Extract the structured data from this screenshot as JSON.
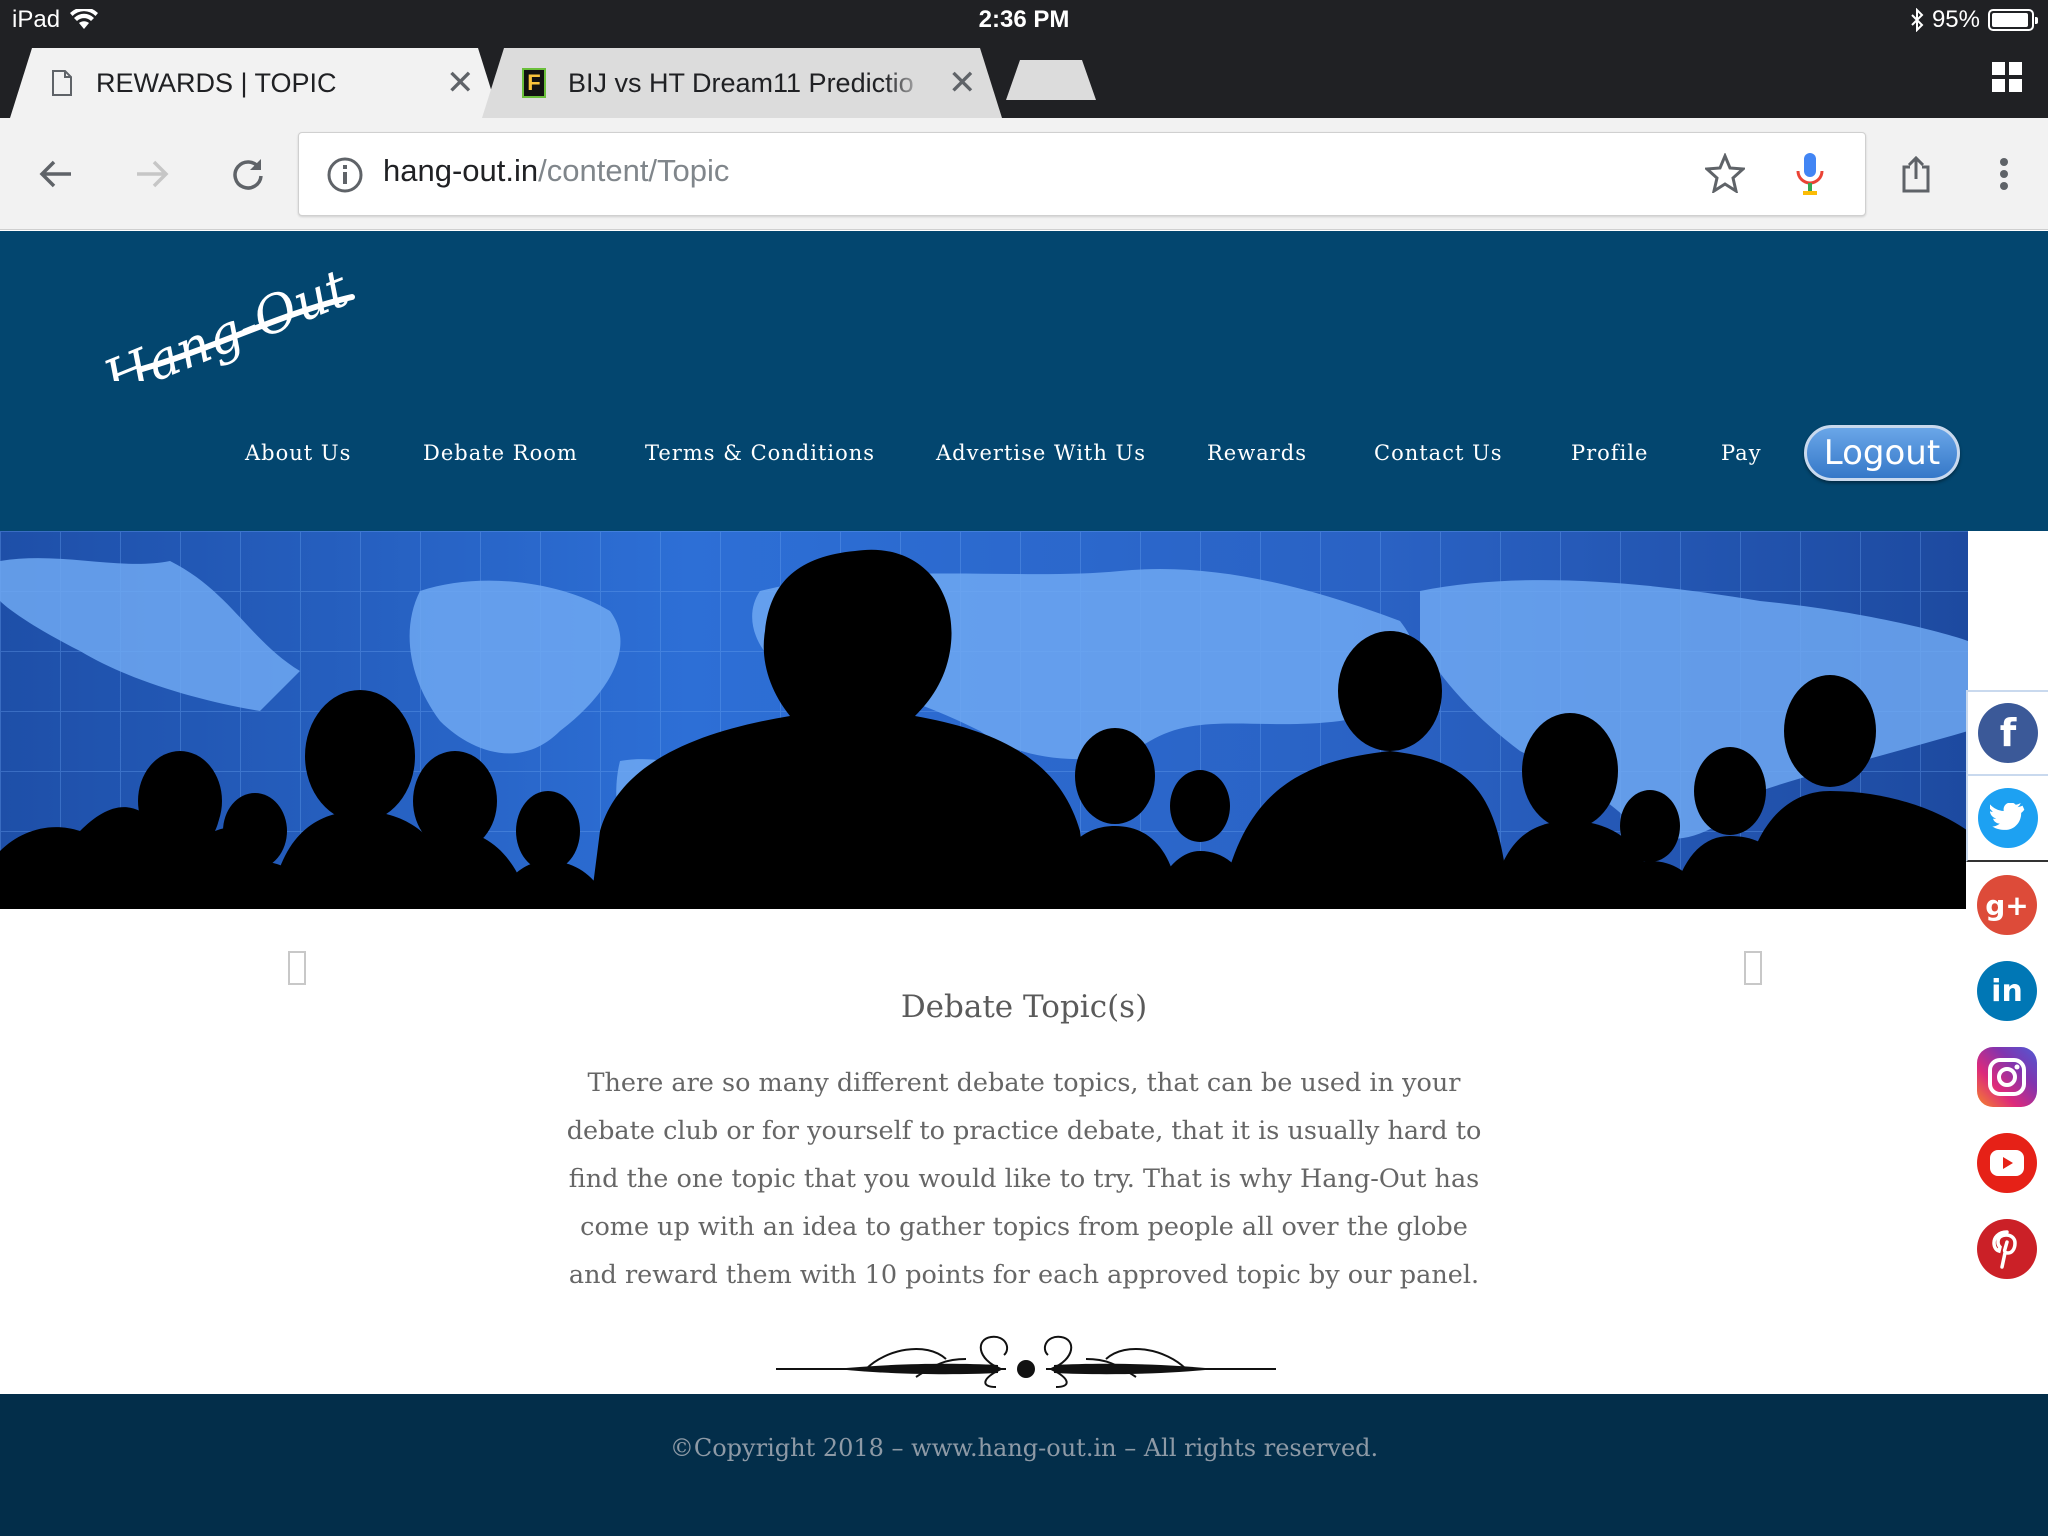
{
  "status_bar": {
    "device": "iPad",
    "time": "2:36 PM",
    "battery": "95%",
    "battery_level": 0.95
  },
  "tabs": [
    {
      "title": "REWARDS | TOPIC",
      "active": true
    },
    {
      "title": "BIJ vs HT Dream11 Predictio",
      "active": false,
      "favicon": "F"
    }
  ],
  "toolbar": {
    "url_host": "hang-out.in",
    "url_path": "/content/Topic"
  },
  "site": {
    "logo_text": "Hang-Out",
    "nav": [
      "About Us",
      "Debate Room",
      "Terms & Conditions",
      "Advertise With Us",
      "Rewards",
      "Contact Us",
      "Profile",
      "Pay"
    ],
    "logout_label": "Logout",
    "header_color": "#03466f",
    "footer_color": "#032e4a"
  },
  "social": [
    "facebook-icon",
    "twitter-icon",
    "google-plus-icon",
    "linkedin-icon",
    "instagram-icon",
    "youtube-icon",
    "pinterest-icon"
  ],
  "social_glyphs": {
    "facebook": "f",
    "google_plus": "g+",
    "linkedin": "in"
  },
  "content": {
    "title": "Debate Topic(s)",
    "body": "There are so many different debate topics, that can be used in your debate club or for yourself to practice debate, that it is usually hard to find the one topic that you would like to try. That is why Hang-Out has come up with an idea to gather topics from people all over the globe and reward them with 10 points for each approved topic by our panel."
  },
  "footer": {
    "copyright": "©Copyright 2018 – www.hang-out.in – All rights reserved."
  }
}
